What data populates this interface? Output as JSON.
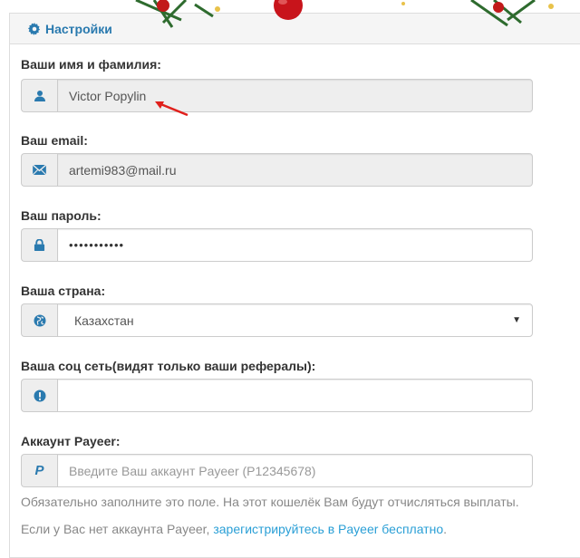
{
  "header": {
    "title": "Настройки"
  },
  "fields": {
    "name": {
      "label": "Ваши имя и фамилия:",
      "value": "Victor Popylin"
    },
    "email": {
      "label": "Ваш email:",
      "value": "artemi983@mail.ru"
    },
    "password": {
      "label": "Ваш пароль:",
      "value": "•••••••••••"
    },
    "country": {
      "label": "Ваша страна:",
      "value": "Казахстан"
    },
    "social": {
      "label": "Ваша соц сеть(видят только ваши рефералы):",
      "value": ""
    },
    "payeer": {
      "label": "Аккаунт Payeer:",
      "placeholder": "Введите Ваш аккаунт Payeer (P12345678)",
      "addon_letter": "P"
    }
  },
  "help": {
    "payeer_required": "Обязательно заполните это поле. На этот кошелёк Вам будут отчисляться выплаты.",
    "no_account_prefix": "Если у Вас нет аккаунта Payeer, ",
    "register_link": "зарегистрируйтесь в Payeer бесплатно",
    "no_account_suffix": "."
  },
  "colors": {
    "heading_text": "#2a7aaf",
    "icon_color": "#2a7aaf",
    "link": "#2a9fd6",
    "annotation_arrow": "#e0201c"
  },
  "icons": {
    "header": "gear-icon",
    "name": "user-icon",
    "email": "envelope-icon",
    "password": "lock-icon",
    "country": "globe-icon",
    "social": "exclamation-icon",
    "payeer": "payeer-icon"
  }
}
